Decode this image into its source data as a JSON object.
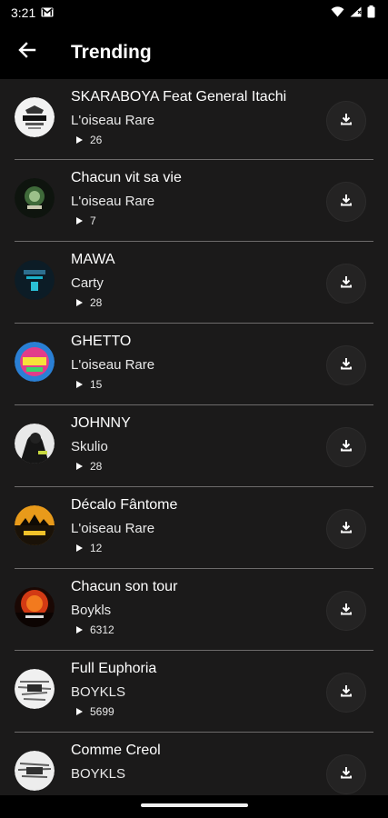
{
  "status_bar": {
    "time": "3:21",
    "icons": [
      "gmail-icon",
      "wifi-icon",
      "signal-icon",
      "battery-icon"
    ]
  },
  "header": {
    "title": "Trending",
    "back_icon": "arrow-back-icon"
  },
  "tracks": [
    {
      "title": "SKARABOYA Feat General Itachi",
      "artist": "L'oiseau Rare",
      "plays": "26"
    },
    {
      "title": "Chacun vit sa vie",
      "artist": "L'oiseau Rare",
      "plays": "7"
    },
    {
      "title": "MAWA",
      "artist": "Carty",
      "plays": "28"
    },
    {
      "title": "GHETTO",
      "artist": "L'oiseau Rare",
      "plays": "15"
    },
    {
      "title": "JOHNNY",
      "artist": "Skulio",
      "plays": "28"
    },
    {
      "title": "Décalo Fântome",
      "artist": "L'oiseau Rare",
      "plays": "12"
    },
    {
      "title": "Chacun son tour",
      "artist": "Boykls",
      "plays": "6312"
    },
    {
      "title": "Full Euphoria",
      "artist": "BOYKLS",
      "plays": "5699"
    },
    {
      "title": "Comme Creol",
      "artist": "BOYKLS",
      "plays": ""
    }
  ],
  "download_icon": "download-icon",
  "play_icon": "play-count-icon"
}
